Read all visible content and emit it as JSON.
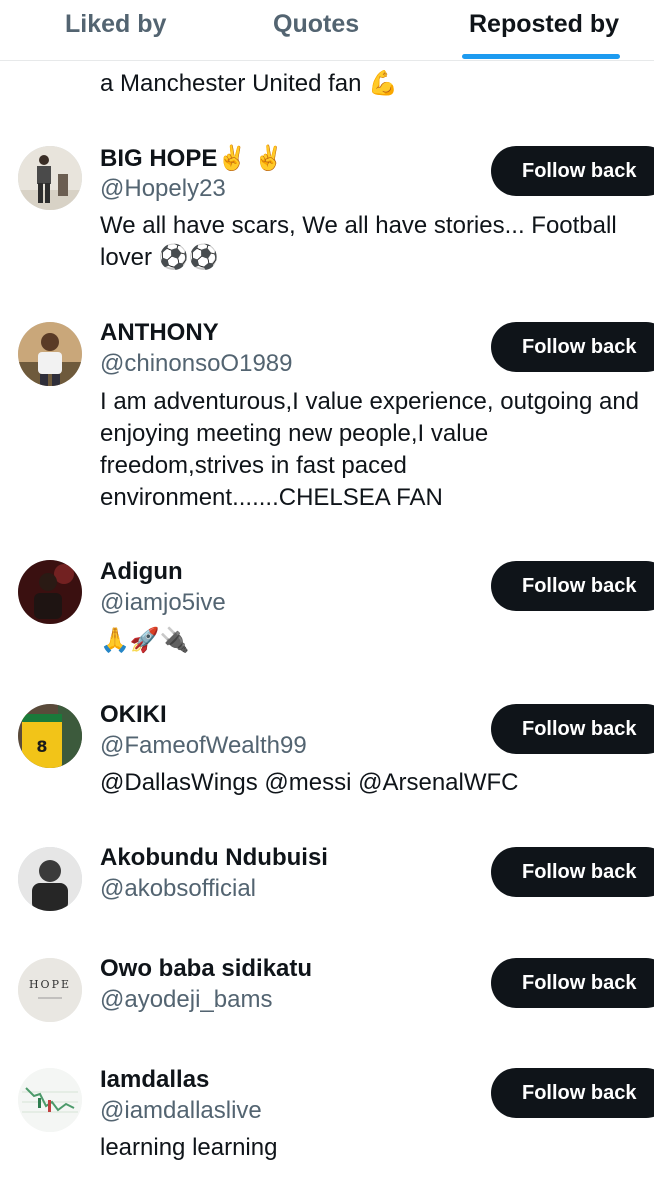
{
  "tabs": [
    {
      "label": "Liked by",
      "active": false
    },
    {
      "label": "Quotes",
      "active": false
    },
    {
      "label": "Reposted by",
      "active": true
    }
  ],
  "partial_bio": "a Manchester United fan 💪",
  "follow_label": "Follow back",
  "users": [
    {
      "name": "BIG HOPE✌️ ✌️",
      "handle": "@Hopely23",
      "bio": "We all have scars, We all have stories... Football lover ⚽⚽",
      "avatar_icon": "avatar-man-standing"
    },
    {
      "name": "ANTHONY",
      "handle": "@chinonsoO1989",
      "bio": "I am adventurous,I value experience, outgoing and enjoying meeting new people,I value freedom,strives in fast paced environment.......CHELSEA FAN",
      "avatar_icon": "avatar-man-white-shirt"
    },
    {
      "name": "Adigun",
      "handle": "@iamjo5ive",
      "bio": "🙏🚀🔌",
      "avatar_icon": "avatar-man-dark-red"
    },
    {
      "name": "OKIKI",
      "handle": "@FameofWealth99",
      "bio": "@DallasWings @messi @ArsenalWFC",
      "avatar_icon": "avatar-yellow-jersey-8"
    },
    {
      "name": "Akobundu Ndubuisi",
      "handle": "@akobsofficial",
      "bio": "",
      "avatar_icon": "avatar-man-grayscale"
    },
    {
      "name": "Owo baba sidikatu",
      "handle": "@ayodeji_bams",
      "bio": "",
      "avatar_icon": "avatar-hope-text",
      "avatar_text": "HOPE"
    },
    {
      "name": "Iamdallas",
      "handle": "@iamdallaslive",
      "bio": "learning learning",
      "avatar_icon": "avatar-chart"
    }
  ],
  "colors": {
    "accent": "#1d9bf0",
    "button_bg": "#0f1419",
    "secondary_text": "#536471"
  }
}
